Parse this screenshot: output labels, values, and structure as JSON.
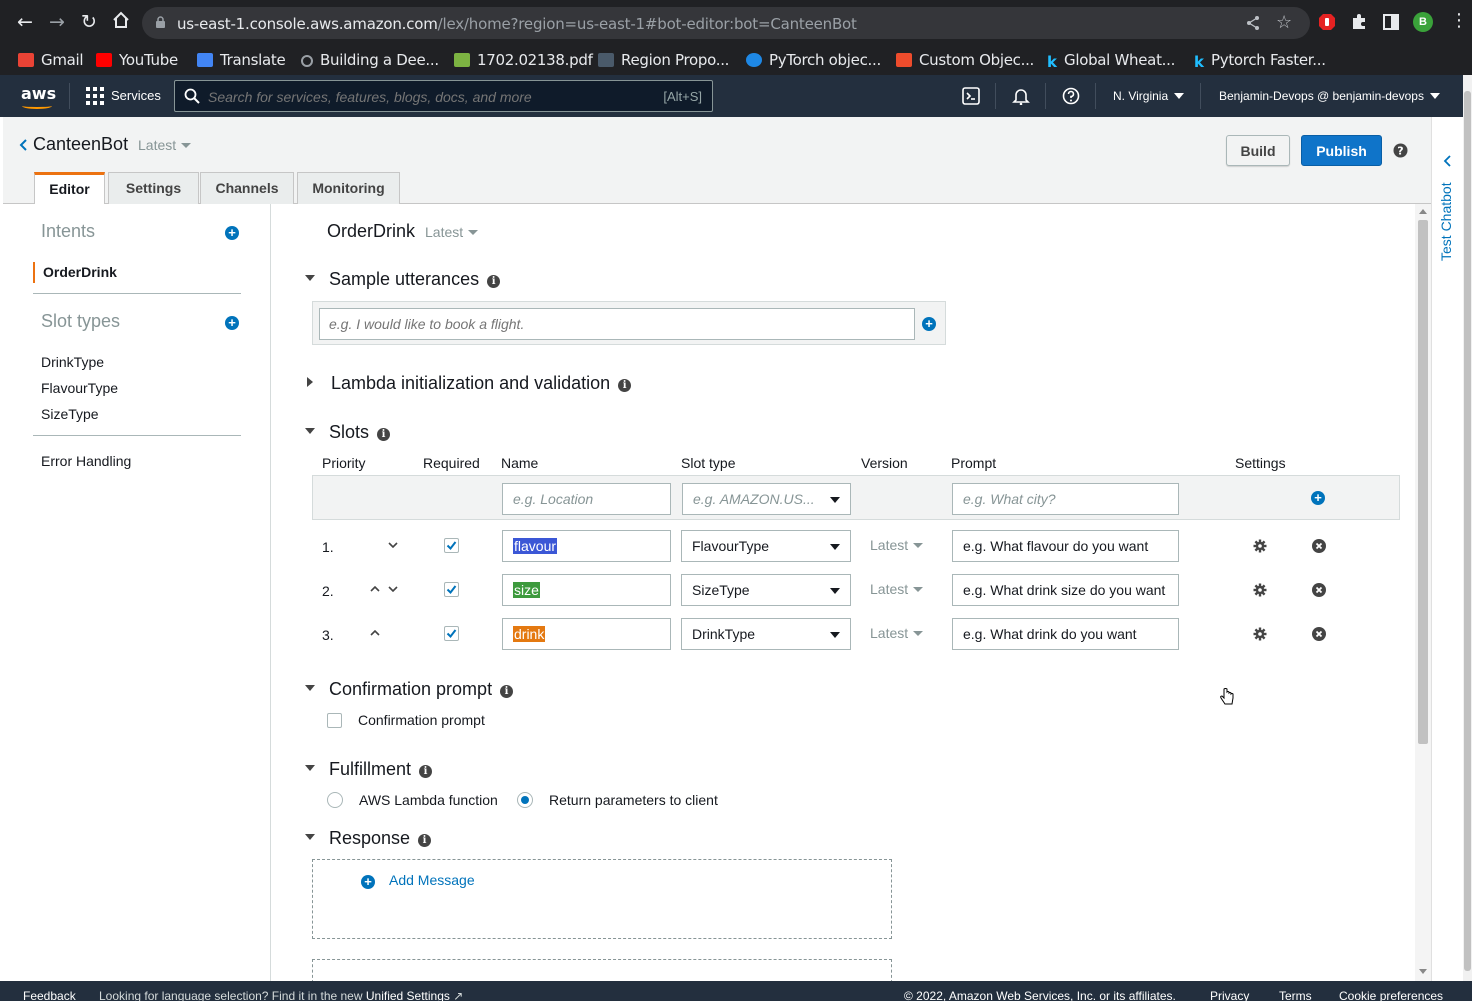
{
  "browser": {
    "url_host": "us-east-1.console.aws.amazon.com",
    "url_path": "/lex/home?region=us-east-1#bot-editor:bot=CanteenBot",
    "profile_initial": "B",
    "bookmarks": [
      {
        "label": "Gmail",
        "icon": "gmail-icon",
        "color": "#ea4335"
      },
      {
        "label": "YouTube",
        "icon": "youtube-icon",
        "color": "#ff0000"
      },
      {
        "label": "Translate",
        "icon": "translate-icon",
        "color": "#4285f4"
      },
      {
        "label": "Building a Dee...",
        "icon": "link-icon",
        "color": "#9aa0a6"
      },
      {
        "label": "1702.02138.pdf",
        "icon": "pdf-icon",
        "color": "#7cb342"
      },
      {
        "label": "Region Propo...",
        "icon": "site-icon",
        "color": "#4a5a6a"
      },
      {
        "label": "PyTorch objec...",
        "icon": "pytorch-icon",
        "color": "#1e88e5"
      },
      {
        "label": "Custom Objec...",
        "icon": "custom-icon",
        "color": "#ee4c2c"
      },
      {
        "label": "Global Wheat...",
        "icon": "kaggle-icon",
        "color": "#20beff"
      },
      {
        "label": "Pytorch Faster...",
        "icon": "kaggle-icon",
        "color": "#20beff"
      }
    ]
  },
  "aws_nav": {
    "logo": "aws",
    "services_label": "Services",
    "search_placeholder": "Search for services, features, blogs, docs, and more",
    "search_shortcut": "[Alt+S]",
    "region": "N. Virginia",
    "account": "Benjamin-Devops @ benjamin-devops"
  },
  "bot": {
    "name": "CanteenBot",
    "version": "Latest",
    "build_label": "Build",
    "publish_label": "Publish",
    "tabs": [
      {
        "label": "Editor",
        "active": true
      },
      {
        "label": "Settings",
        "active": false
      },
      {
        "label": "Channels",
        "active": false
      },
      {
        "label": "Monitoring",
        "active": false
      }
    ],
    "test_chatbot_label": "Test Chatbot"
  },
  "sidebar": {
    "intents_title": "Intents",
    "intents": [
      "OrderDrink"
    ],
    "slot_types_title": "Slot types",
    "slot_types": [
      "DrinkType",
      "FlavourType",
      "SizeType"
    ],
    "error_handling": "Error Handling"
  },
  "intent": {
    "name": "OrderDrink",
    "version": "Latest",
    "sample_utterances": {
      "title": "Sample utterances",
      "placeholder": "e.g. I would like to book a flight."
    },
    "lambda_init": {
      "title": "Lambda initialization and validation"
    },
    "slots": {
      "title": "Slots",
      "columns": {
        "priority": "Priority",
        "required": "Required",
        "name": "Name",
        "slot_type": "Slot type",
        "version": "Version",
        "prompt": "Prompt",
        "settings": "Settings"
      },
      "new_row": {
        "name_placeholder": "e.g. Location",
        "type_placeholder": "e.g. AMAZON.US...",
        "prompt_placeholder": "e.g. What city?"
      },
      "rows": [
        {
          "priority": "1.",
          "required": true,
          "name": "flavour",
          "highlight": "#3b57d6",
          "type": "FlavourType",
          "version": "Latest",
          "prompt": "e.g. What flavour do you want"
        },
        {
          "priority": "2.",
          "required": true,
          "name": "size",
          "highlight": "#3d9a3d",
          "type": "SizeType",
          "version": "Latest",
          "prompt": "e.g. What drink size do you want"
        },
        {
          "priority": "3.",
          "required": true,
          "name": "drink",
          "highlight": "#e47911",
          "type": "DrinkType",
          "version": "Latest",
          "prompt": "e.g. What drink do you want"
        }
      ]
    },
    "confirmation": {
      "title": "Confirmation prompt",
      "checkbox_label": "Confirmation prompt",
      "checked": false
    },
    "fulfillment": {
      "title": "Fulfillment",
      "option_lambda": "AWS Lambda function",
      "option_return": "Return parameters to client",
      "selected": "return"
    },
    "response": {
      "title": "Response",
      "add_message": "Add Message"
    }
  },
  "footer": {
    "feedback": "Feedback",
    "hint": "Looking for language selection? Find it in the new",
    "unified_settings": "Unified Settings",
    "copyright": "© 2022, Amazon Web Services, Inc. or its affiliates.",
    "privacy": "Privacy",
    "terms": "Terms",
    "cookie": "Cookie preferences"
  },
  "colors": {
    "aws_nav_bg": "#232f3e",
    "accent_orange": "#ec7211",
    "primary_blue": "#0f74c9",
    "link_blue": "#0073bb"
  }
}
